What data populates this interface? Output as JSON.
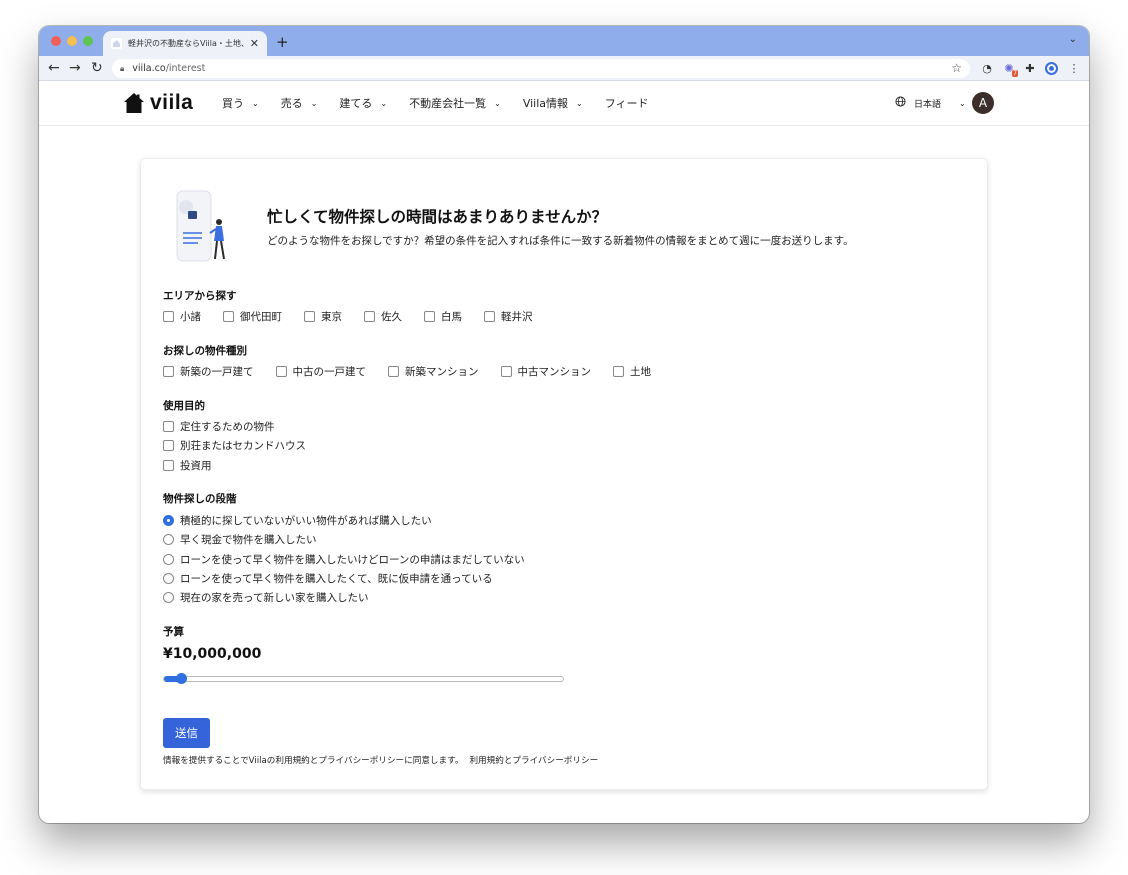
{
  "browser": {
    "tab_title": "軽井沢の不動産ならViila・土地、一",
    "tab_close": "✕",
    "new_tab": "+",
    "tab_menu": "⌄",
    "url_host": "viila.co",
    "url_path": "/interest",
    "ext_badge": "7"
  },
  "header": {
    "logo_text": "viila",
    "nav": [
      {
        "label": "買う",
        "has_menu": true
      },
      {
        "label": "売る",
        "has_menu": true
      },
      {
        "label": "建てる",
        "has_menu": true
      },
      {
        "label": "不動産会社一覧",
        "has_menu": true
      },
      {
        "label": "Viila情報",
        "has_menu": true
      },
      {
        "label": "フィード",
        "has_menu": false
      }
    ],
    "language": "日本語",
    "avatar_initial": "A"
  },
  "intro": {
    "headline": "忙しくて物件探しの時間はあまりありませんか？",
    "description": "どのような物件をお探しですか？希望の条件を記入すれば条件に一致する新着物件の情報をまとめて週に一度お送りします。"
  },
  "sections": {
    "area": {
      "title": "エリアから探す",
      "options": [
        "小諸",
        "御代田町",
        "東京",
        "佐久",
        "白馬",
        "軽井沢"
      ]
    },
    "property_type": {
      "title": "お探しの物件種別",
      "options": [
        "新築の一戸建て",
        "中古の一戸建て",
        "新築マンション",
        "中古マンション",
        "土地"
      ]
    },
    "purpose": {
      "title": "使用目的",
      "options": [
        "定住するための物件",
        "別荘またはセカンドハウス",
        "投資用"
      ]
    },
    "stage": {
      "title": "物件探しの段階",
      "selected_index": 0,
      "options": [
        "積極的に探していないがいい物件があれば購入したい",
        "早く現金で物件を購入したい",
        "ローンを使って早く物件を購入したいけどローンの申請はまだしていない",
        "ローンを使って早く物件を購入したくて、既に仮申請を通っている",
        "現在の家を売って新しい家を購入したい"
      ]
    },
    "budget": {
      "title": "予算",
      "value_display": "¥10,000,000",
      "slider_fraction": 0.043
    }
  },
  "form": {
    "submit_label": "送信",
    "terms_text": "情報を提供することでViilaの利用規約とプライバシーポリシーに同意します。",
    "terms_link": "利用規約とプライバシーポリシー"
  },
  "colors": {
    "accent": "#3563d9",
    "tabbar": "#8fadea",
    "avatar": "#3c2e28"
  }
}
